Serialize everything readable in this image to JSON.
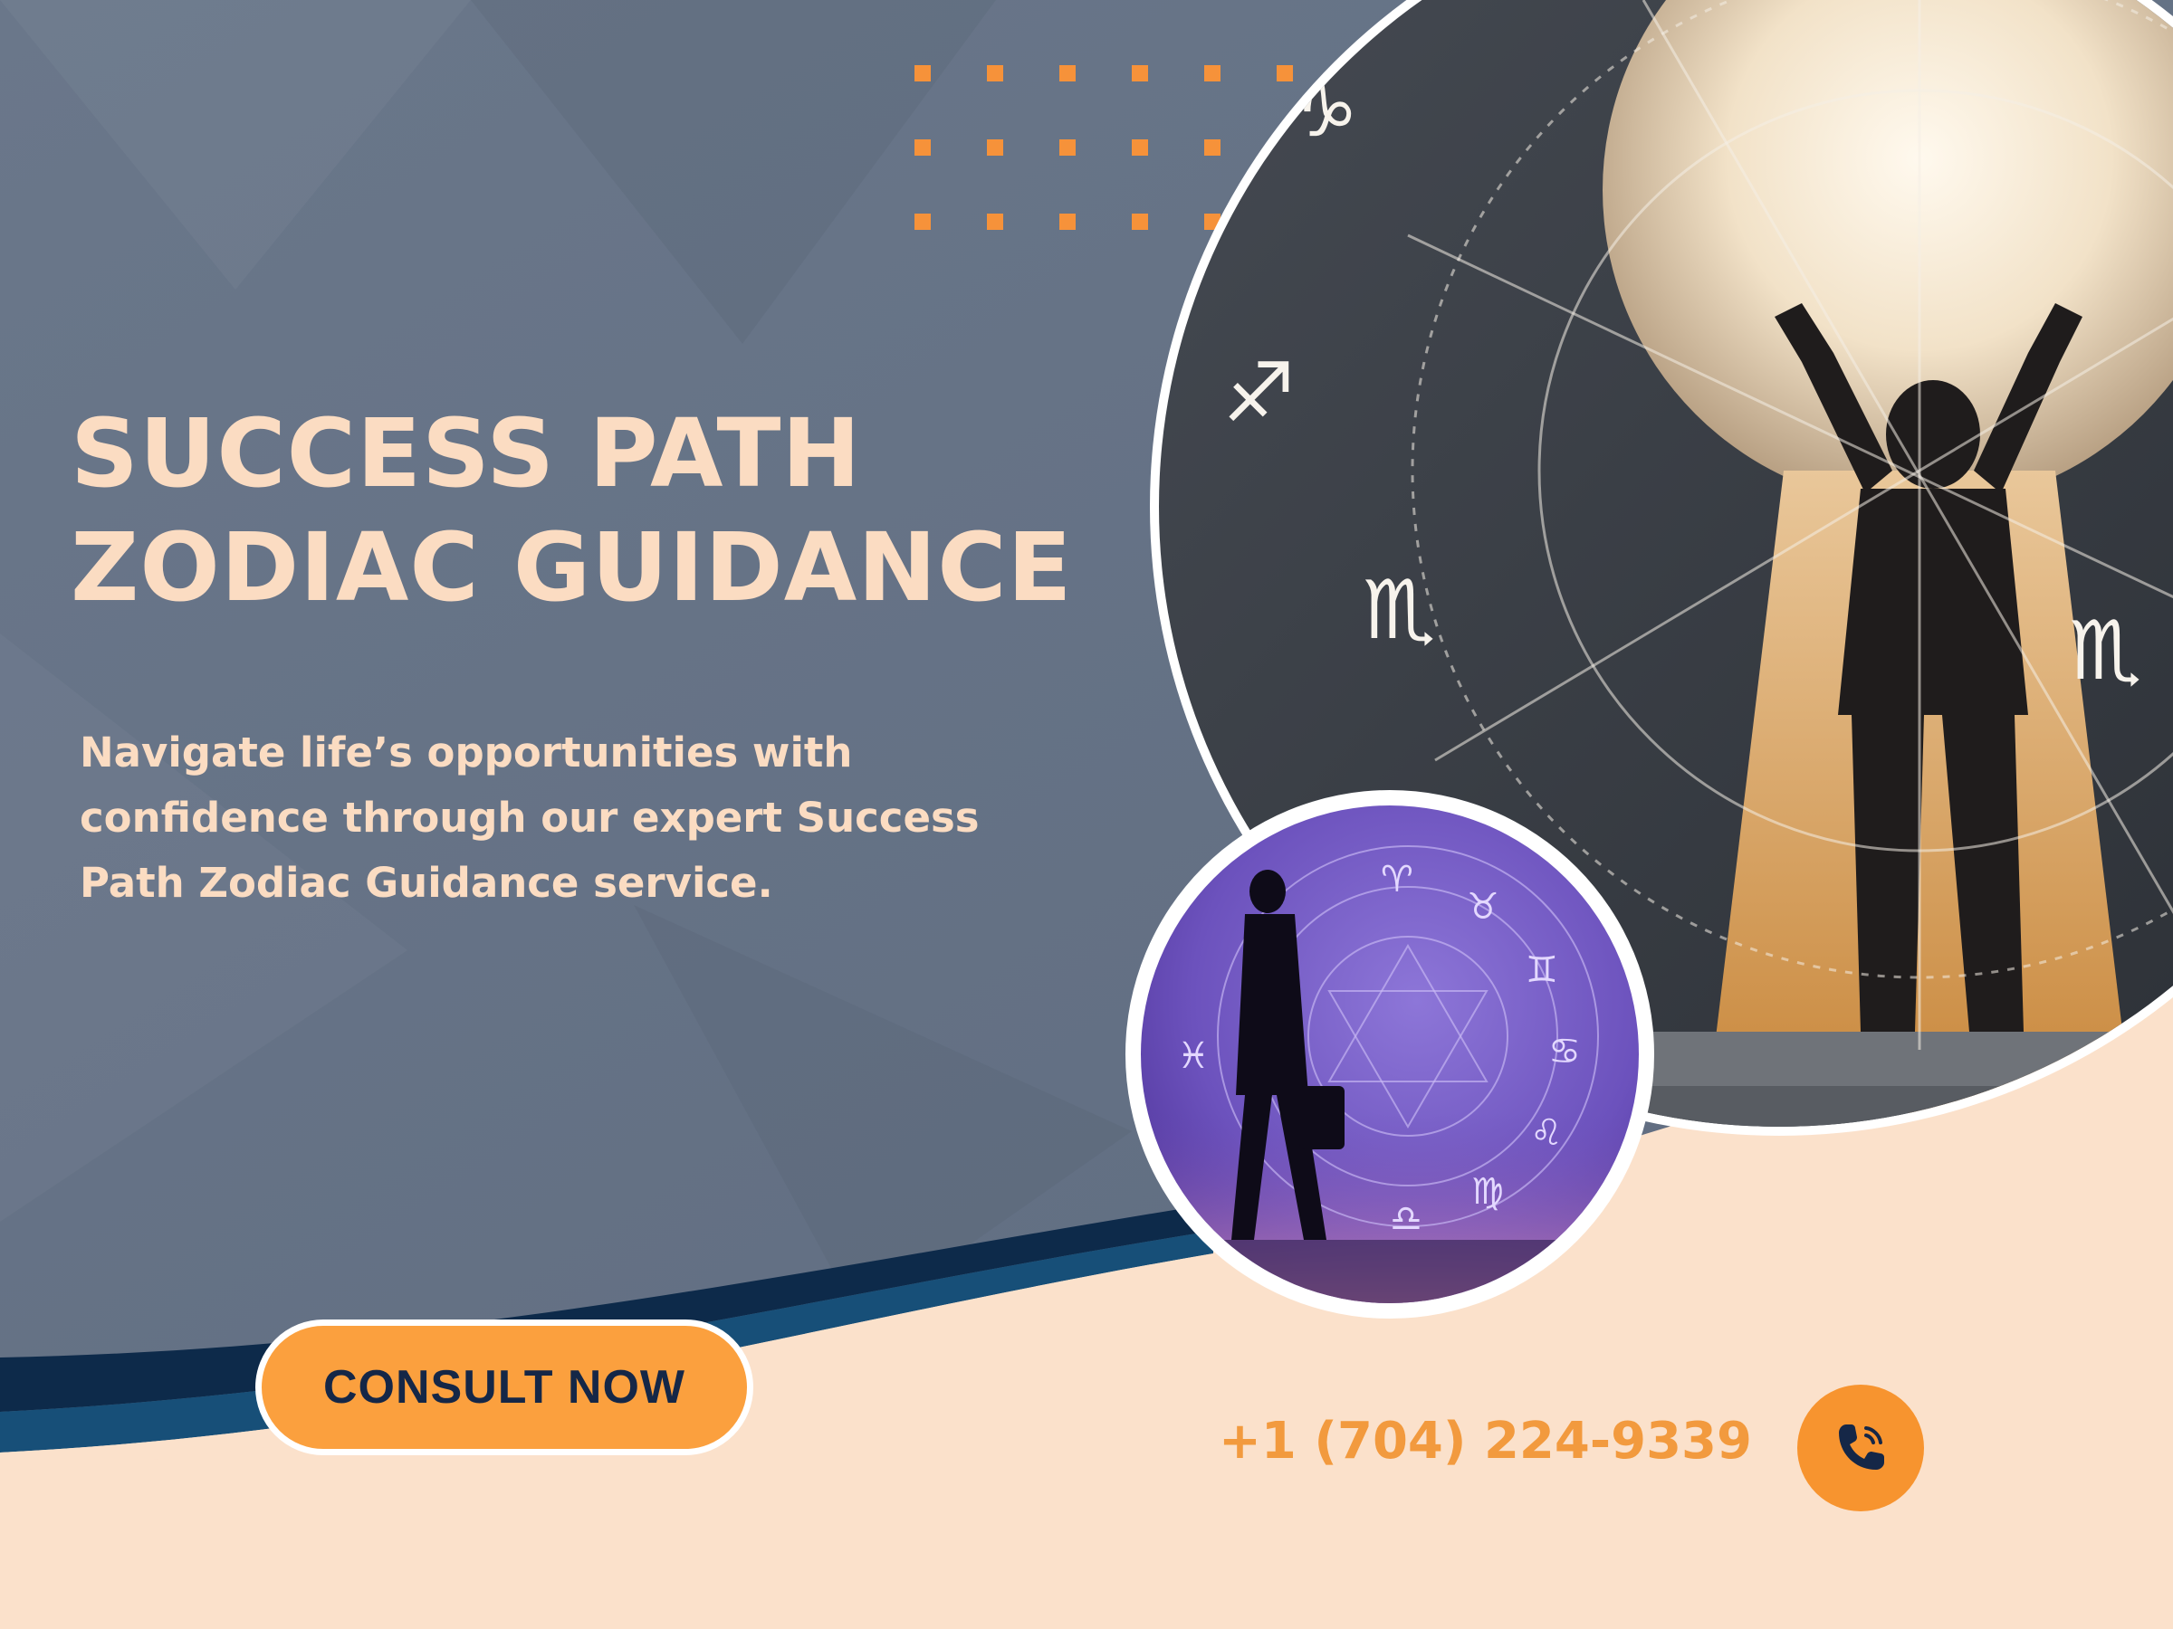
{
  "headline": {
    "line1": "SUCCESS PATH",
    "line2": "ZODIAC GUIDANCE"
  },
  "description": "Navigate life’s opportunities with confidence through our expert Success Path Zodiac Guidance service.",
  "cta": {
    "label": "CONSULT NOW"
  },
  "contact": {
    "phone": "+1 (704) 224-9339",
    "icon": "phone-icon"
  },
  "colors": {
    "slate_panel": "#667487",
    "cream": "#fbe1cb",
    "accent_orange": "#f7942f",
    "navy": "#152747",
    "heading_text": "#fbdcc2"
  }
}
